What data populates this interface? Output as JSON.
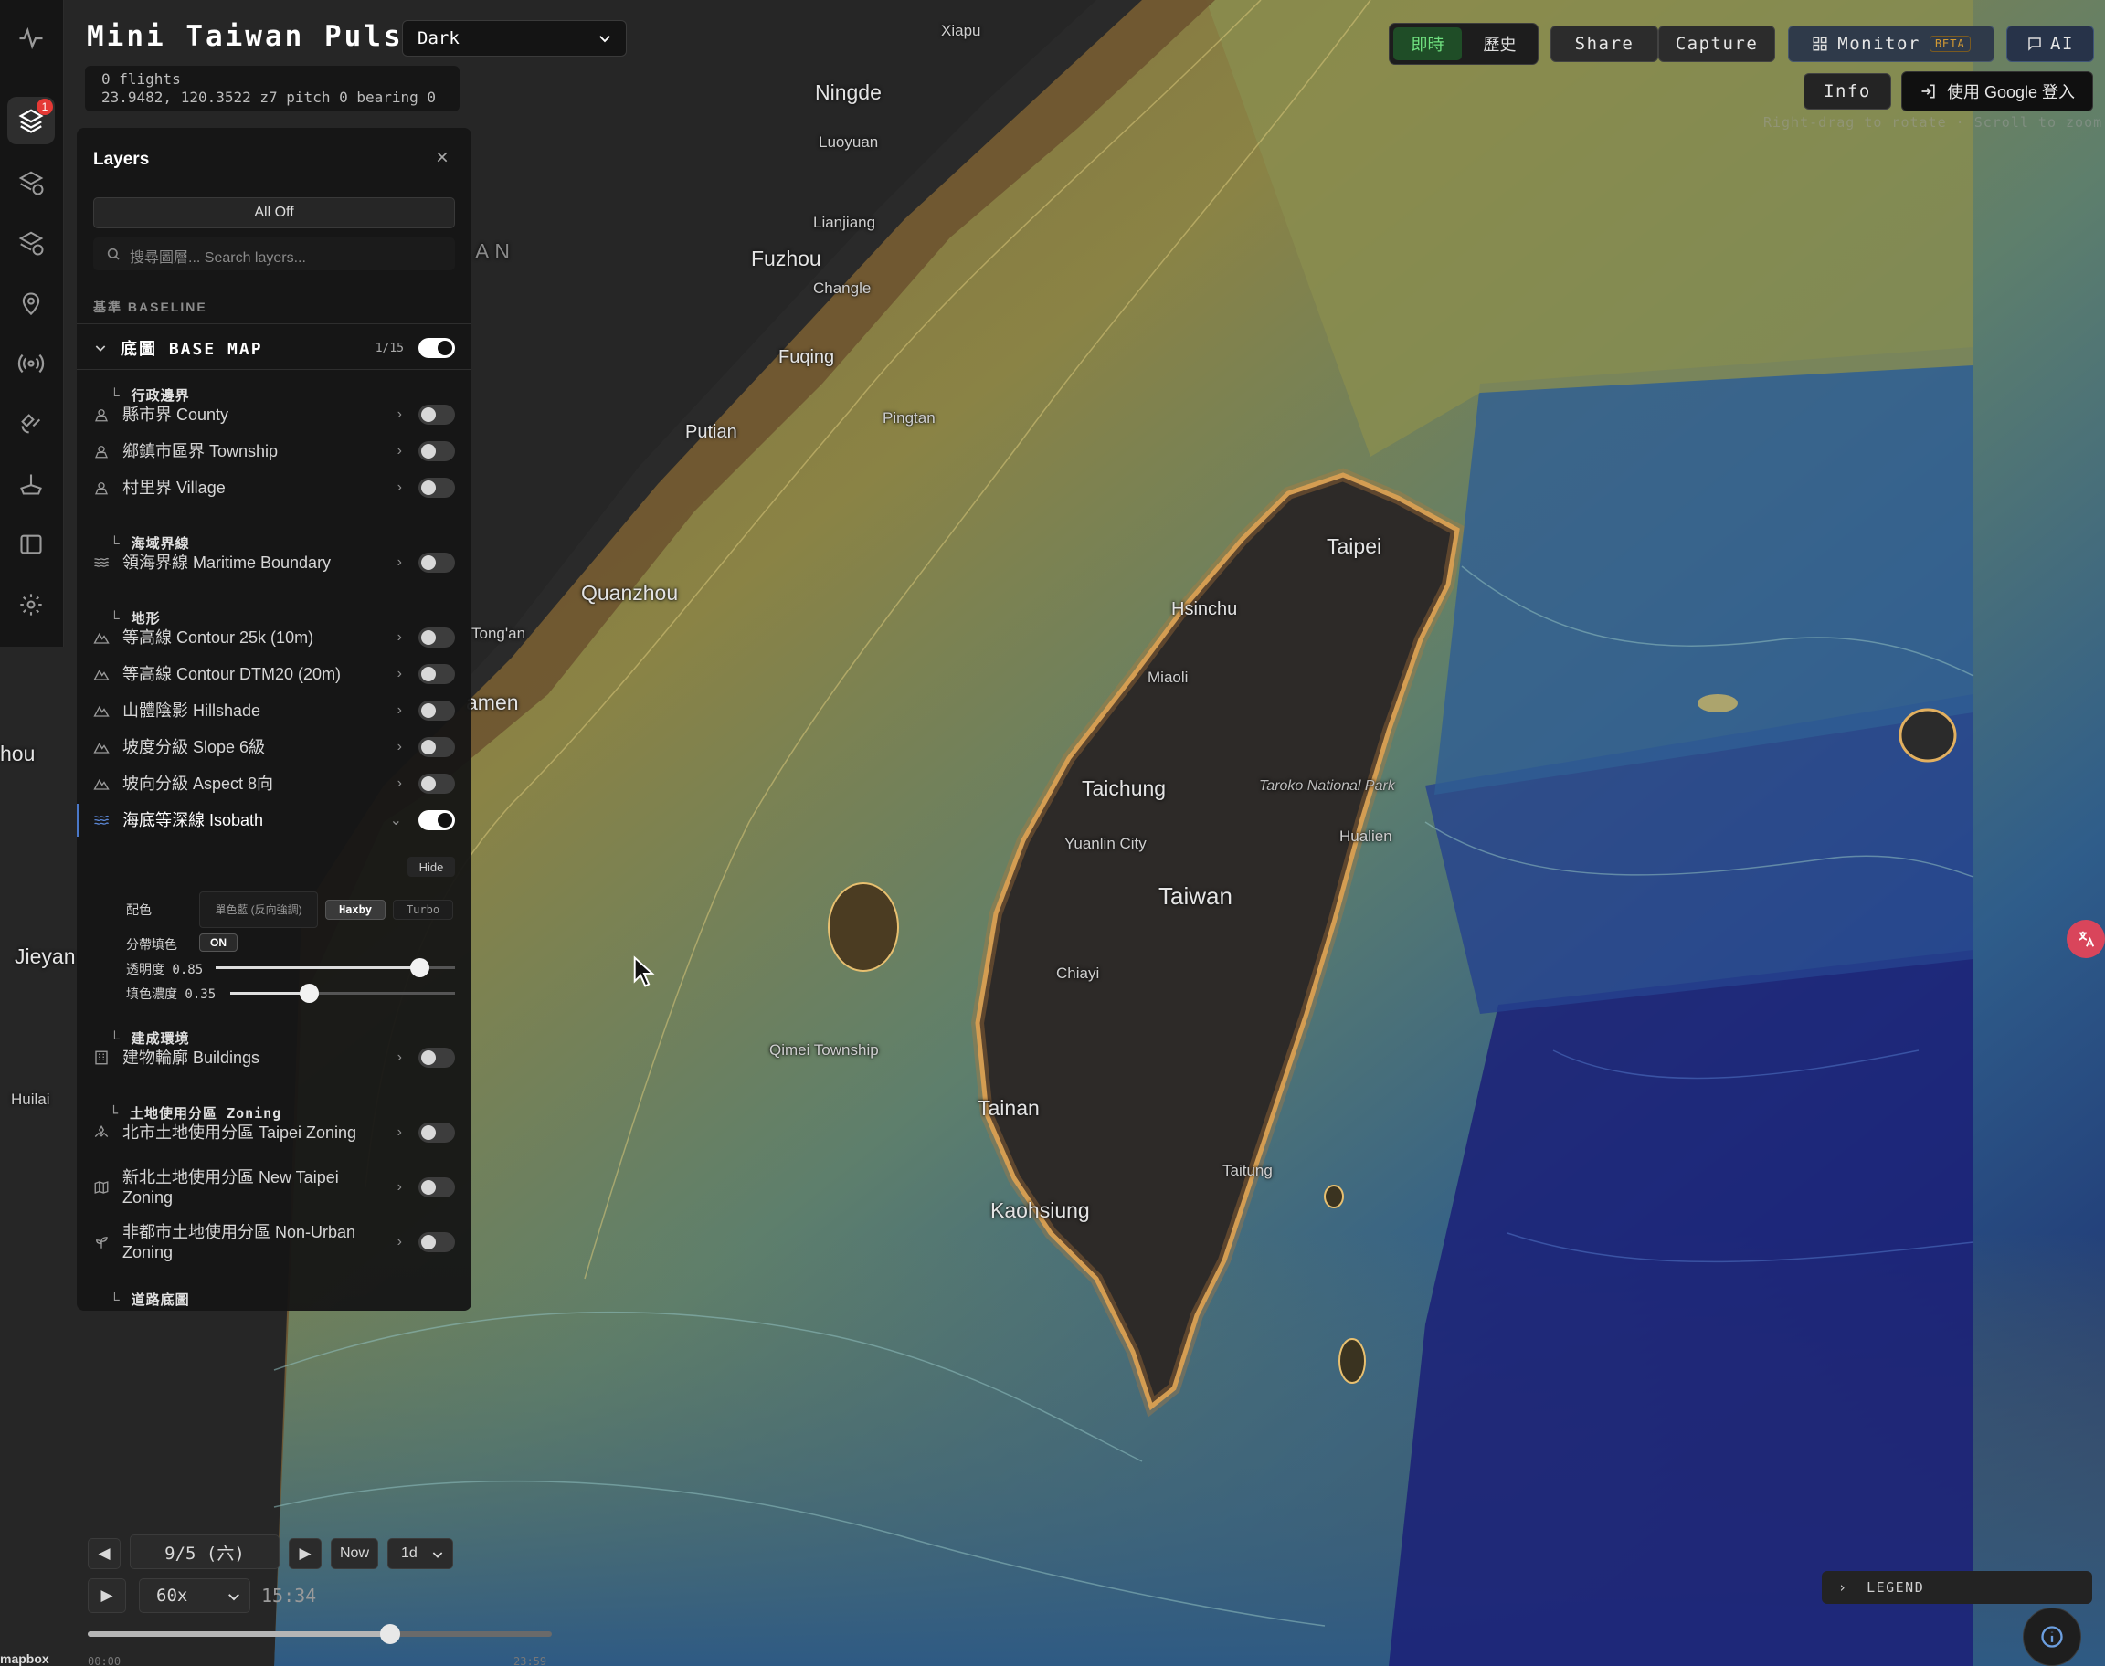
{
  "app": {
    "title": "Mini Taiwan Pulse",
    "theme": "Dark"
  },
  "status": {
    "flights": "0 flights",
    "camera": "23.9482, 120.3522 z7 pitch 0 bearing 0"
  },
  "rail": {
    "notification_count": "1"
  },
  "topbar": {
    "mode_live": "即時",
    "mode_history": "歷史",
    "share": "Share",
    "capture": "Capture",
    "monitor": "Monitor",
    "monitor_badge": "BETA",
    "ai": "AI",
    "info": "Info",
    "login": "使用 Google 登入",
    "hint": "Right-drag to rotate · Scroll to zoom"
  },
  "layers": {
    "title": "Layers",
    "all_off": "All Off",
    "search_placeholder": "搜尋圖層... Search layers...",
    "section": "基準 BASELINE",
    "group": {
      "name": "底圖 BASE MAP",
      "count": "1/15",
      "on": true
    },
    "subgroups": {
      "admin": "行政邊界",
      "maritime": "海域界線",
      "terrain": "地形",
      "built": "建成環境",
      "zoning": "土地使用分區 Zoning",
      "roads": "道路底圖"
    },
    "items": [
      {
        "label": "縣市界 County",
        "icon": "boundary-icon",
        "on": false
      },
      {
        "label": "鄉鎮市區界 Township",
        "icon": "boundary-icon",
        "on": false
      },
      {
        "label": "村里界 Village",
        "icon": "boundary-icon",
        "on": false
      },
      {
        "label": "領海界線 Maritime Boundary",
        "icon": "waves-icon",
        "on": false
      },
      {
        "label": "等高線 Contour 25k (10m)",
        "icon": "mountain-icon",
        "on": false
      },
      {
        "label": "等高線 Contour DTM20 (20m)",
        "icon": "mountain-icon",
        "on": false
      },
      {
        "label": "山體陰影 Hillshade",
        "icon": "mountain-icon",
        "on": false
      },
      {
        "label": "坡度分級 Slope 6級",
        "icon": "mountain-icon",
        "on": false
      },
      {
        "label": "坡向分級 Aspect 8向",
        "icon": "mountain-icon",
        "on": false
      },
      {
        "label": "海底等深線 Isobath",
        "icon": "waves-icon",
        "on": true
      },
      {
        "label": "建物輪廓 Buildings",
        "icon": "building-icon",
        "on": false
      },
      {
        "label": "北市土地使用分區 Taipei Zoning",
        "icon": "zoning-icon",
        "on": false
      },
      {
        "label": "新北土地使用分區 New Taipei Zoning",
        "icon": "map-icon",
        "on": false
      },
      {
        "label": "非都市土地使用分區 Non-Urban Zoning",
        "icon": "plant-icon",
        "on": false
      }
    ],
    "isobath": {
      "hide": "Hide",
      "color_label": "配色",
      "color_options": [
        "單色藍 (反向強調)",
        "Haxby",
        "Turbo"
      ],
      "color_selected": "Haxby",
      "band_fill_label": "分帶填色",
      "band_fill_value": "ON",
      "opacity_label": "透明度 0.85",
      "opacity": 0.85,
      "fill_label": "填色濃度 0.35",
      "fill": 0.35
    }
  },
  "timeline": {
    "prev": "◀",
    "next": "▶",
    "date": "9/5 (六)",
    "now": "Now",
    "range": "1d",
    "play": "▶",
    "speed": "60x",
    "time": "15:34",
    "progress": 0.65,
    "tick_start": "00:00",
    "tick_end": "23:59"
  },
  "legend": {
    "label": "LEGEND"
  },
  "map": {
    "logo": "mapbox",
    "places": [
      {
        "name": "Xiapu",
        "cls": "sm"
      },
      {
        "name": "Ningde",
        "cls": "big"
      },
      {
        "name": "Luoyuan",
        "cls": "sm"
      },
      {
        "name": "Lianjiang",
        "cls": "sm"
      },
      {
        "name": "Fuzhou",
        "cls": "big"
      },
      {
        "name": "Changle",
        "cls": "sm"
      },
      {
        "name": "Fuqing",
        "cls": "med"
      },
      {
        "name": "Putian",
        "cls": "med"
      },
      {
        "name": "Pingtan",
        "cls": "sm"
      },
      {
        "name": "Quanzhou",
        "cls": "big"
      },
      {
        "name": "Tong'an",
        "cls": "sm"
      },
      {
        "name": "amen",
        "cls": "big"
      },
      {
        "name": "hou",
        "cls": "big"
      },
      {
        "name": "Jieyan",
        "cls": "big"
      },
      {
        "name": "Huilai",
        "cls": "sm"
      },
      {
        "name": "Taipei",
        "cls": "big"
      },
      {
        "name": "Hsinchu",
        "cls": "med"
      },
      {
        "name": "Miaoli",
        "cls": "sm"
      },
      {
        "name": "Taichung",
        "cls": "big"
      },
      {
        "name": "Taroko National Park",
        "cls": "it"
      },
      {
        "name": "Yuanlin City",
        "cls": "sm"
      },
      {
        "name": "Hualien",
        "cls": "sm"
      },
      {
        "name": "Taiwan",
        "cls": "xl"
      },
      {
        "name": "Chiayi",
        "cls": "sm"
      },
      {
        "name": "Qimei Township",
        "cls": "sm"
      },
      {
        "name": "Tainan",
        "cls": "big"
      },
      {
        "name": "Taitung",
        "cls": "sm"
      },
      {
        "name": "Kaohsiung",
        "cls": "big"
      },
      {
        "name": "AN",
        "cls": "big"
      }
    ]
  }
}
